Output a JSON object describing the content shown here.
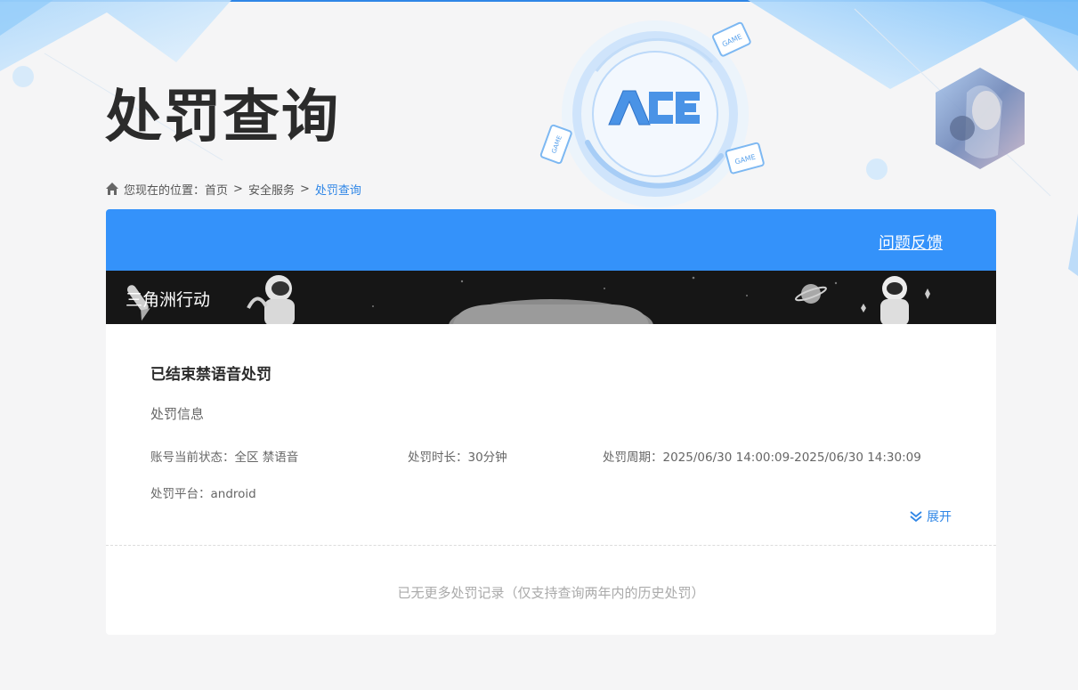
{
  "page": {
    "title": "处罚查询"
  },
  "breadcrumb": {
    "prefix": "您现在的位置：",
    "items": [
      "首页",
      "安全服务",
      "处罚查询"
    ],
    "separator": ">"
  },
  "logo": {
    "text": "ACE",
    "badge_text": "GAME"
  },
  "card": {
    "feedback_label": "问题反馈",
    "game_name": "三角洲行动"
  },
  "record": {
    "title": "已结束禁语音处罚",
    "section_label": "处罚信息",
    "status_key": "账号当前状态：",
    "status_value": "全区 禁语音",
    "duration_key": "处罚时长：",
    "duration_value": "30分钟",
    "period_key": "处罚周期：",
    "period_value": "2025/06/30 14:00:09-2025/06/30 14:30:09",
    "platform_key": "处罚平台：",
    "platform_value": "android",
    "expand_label": "展开"
  },
  "footer_note": "已无更多处罚记录（仅支持查询两年内的历史处罚）",
  "colors": {
    "accent": "#3492fa",
    "link": "#2f86e6",
    "banner_bg": "#161616",
    "page_bg": "#f5f5f6"
  },
  "icons": [
    "home-icon",
    "chevron-double-down-icon",
    "ace-logo-icon",
    "avatar-image"
  ]
}
